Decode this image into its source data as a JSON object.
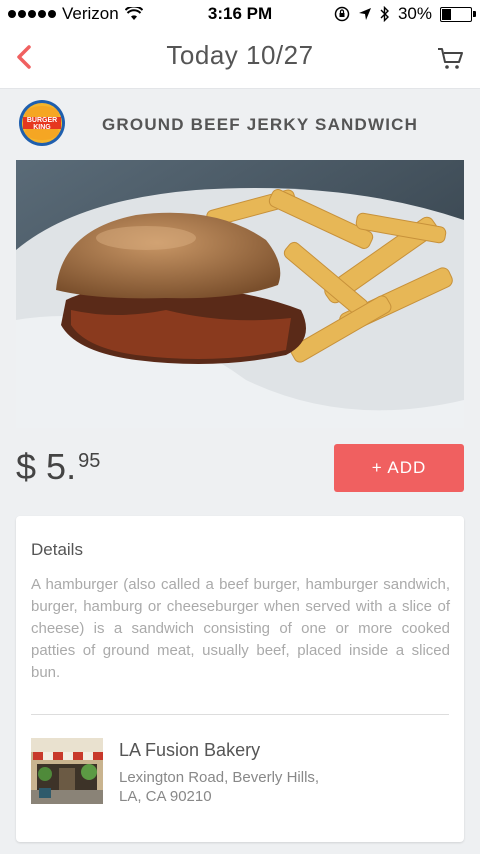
{
  "status_bar": {
    "carrier": "Verizon",
    "time": "3:16 PM",
    "battery": "30%"
  },
  "nav": {
    "title": "Today 10/27",
    "back_icon": "chevron-left-icon",
    "cart_icon": "cart-icon"
  },
  "product": {
    "brand_logo_text": "BURGER KING",
    "name": "GROUND BEEF JERKY SANDWICH",
    "price_currency": "$",
    "price_dollars": "5.",
    "price_cents": "95",
    "add_label": "+ ADD"
  },
  "details": {
    "heading": "Details",
    "description": "A hamburger (also called a beef burger, hamburger sandwich, burger, hamburg or cheeseburger when served with a slice of cheese) is a sandwich consisting of one or more cooked patties of ground meat, usually beef, placed inside a sliced bun."
  },
  "vendor": {
    "name": "LA Fusion Bakery",
    "address_line1": "Lexington Road, Beverly Hills,",
    "address_line2": "LA, CA 90210"
  },
  "colors": {
    "accent": "#f06060",
    "background": "#eef0f2"
  }
}
